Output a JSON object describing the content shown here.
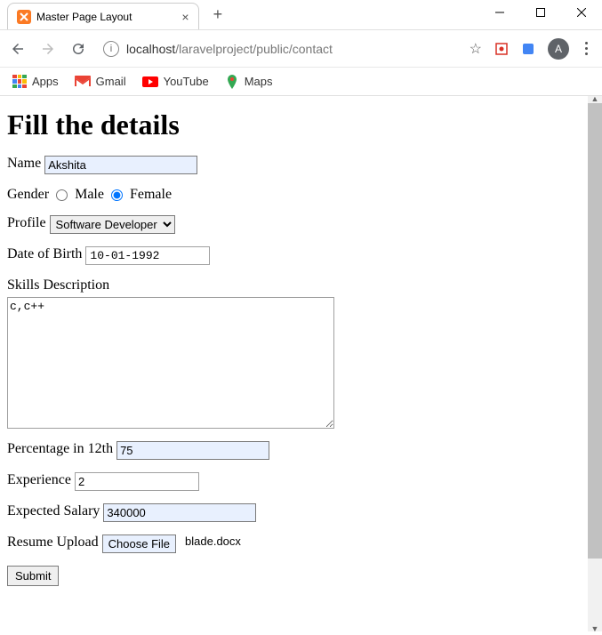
{
  "window": {
    "tab_title": "Master Page Layout",
    "url_host": "localhost",
    "url_path": "/laravelproject/public/contact",
    "avatar_letter": "A"
  },
  "bookmarks": {
    "apps": "Apps",
    "gmail": "Gmail",
    "youtube": "YouTube",
    "maps": "Maps"
  },
  "form": {
    "heading": "Fill the details",
    "name_label": "Name",
    "name_value": "Akshita",
    "gender_label": "Gender",
    "gender_male": "Male",
    "gender_female": "Female",
    "gender_selected": "female",
    "profile_label": "Profile",
    "profile_option": "Software Developer",
    "dob_label": "Date of Birth",
    "dob_value": "10-01-1992",
    "skills_label": "Skills Description",
    "skills_value": "c,c++",
    "percentage_label": "Percentage in 12th",
    "percentage_value": "75",
    "experience_label": "Experience",
    "experience_value": "2",
    "salary_label": "Expected Salary",
    "salary_value": "340000",
    "resume_label": "Resume Upload",
    "choose_file": "Choose File",
    "file_name": "blade.docx",
    "submit": "Submit"
  }
}
